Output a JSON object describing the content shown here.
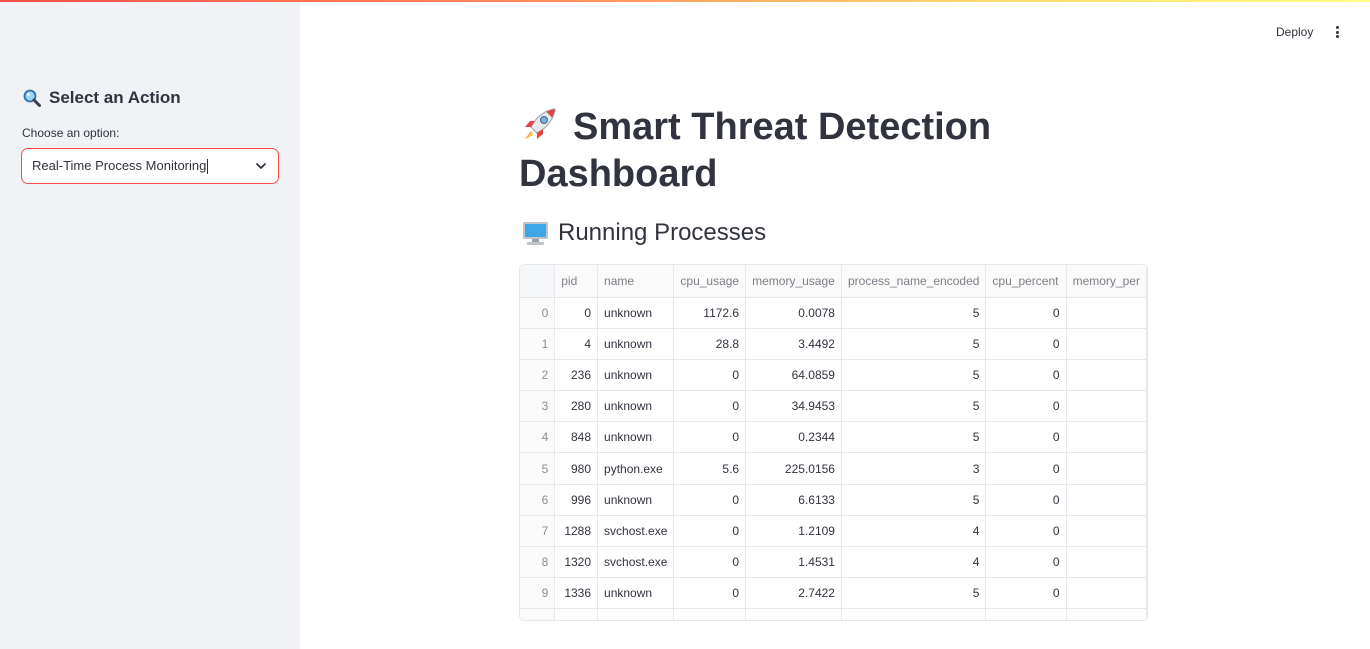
{
  "sidebar": {
    "title": "Select an Action",
    "title_icon": "magnifier-icon",
    "choose_label": "Choose an option:",
    "selected_option": "Real-Time Process Monitoring"
  },
  "header": {
    "deploy_label": "Deploy",
    "menu_icon": "kebab-menu-icon"
  },
  "main": {
    "title": "Smart Threat Detection Dashboard",
    "title_icon": "rocket-icon",
    "subtitle": "Running Processes",
    "subtitle_icon": "computer-icon"
  },
  "table": {
    "columns": [
      "",
      "pid",
      "name",
      "cpu_usage",
      "memory_usage",
      "process_name_encoded",
      "cpu_percent",
      "memory_per"
    ],
    "rows": [
      [
        "0",
        "0",
        "unknown",
        "1172.6",
        "0.0078",
        "5",
        "0",
        ""
      ],
      [
        "1",
        "4",
        "unknown",
        "28.8",
        "3.4492",
        "5",
        "0",
        ""
      ],
      [
        "2",
        "236",
        "unknown",
        "0",
        "64.0859",
        "5",
        "0",
        ""
      ],
      [
        "3",
        "280",
        "unknown",
        "0",
        "34.9453",
        "5",
        "0",
        ""
      ],
      [
        "4",
        "848",
        "unknown",
        "0",
        "0.2344",
        "5",
        "0",
        ""
      ],
      [
        "5",
        "980",
        "python.exe",
        "5.6",
        "225.0156",
        "3",
        "0",
        ""
      ],
      [
        "6",
        "996",
        "unknown",
        "0",
        "6.6133",
        "5",
        "0",
        ""
      ],
      [
        "7",
        "1288",
        "svchost.exe",
        "0",
        "1.2109",
        "4",
        "0",
        ""
      ],
      [
        "8",
        "1320",
        "svchost.exe",
        "0",
        "1.4531",
        "4",
        "0",
        ""
      ],
      [
        "9",
        "1336",
        "unknown",
        "0",
        "2.7422",
        "5",
        "0",
        ""
      ]
    ]
  },
  "colors": {
    "accent": "#ff4b4b",
    "sidebar_bg": "#f0f2f6",
    "text": "#31333f"
  }
}
